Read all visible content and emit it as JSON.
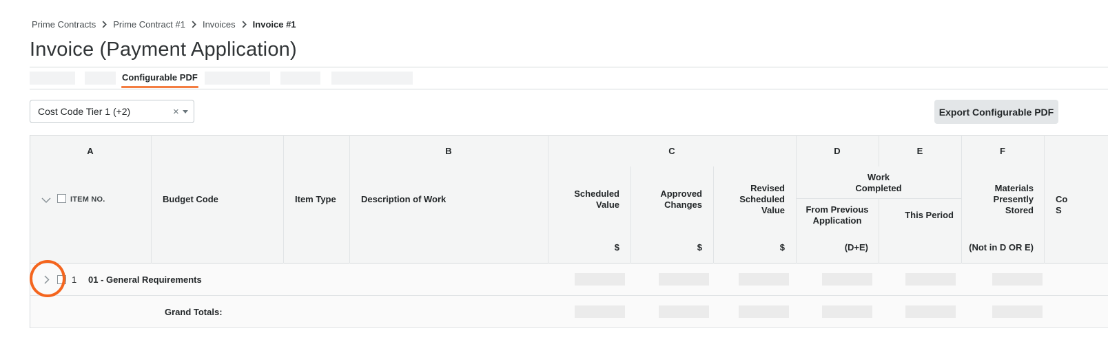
{
  "breadcrumb": [
    {
      "label": "Prime Contracts"
    },
    {
      "label": "Prime Contract #1"
    },
    {
      "label": "Invoices"
    },
    {
      "label": "Invoice #1"
    }
  ],
  "page": {
    "title": "Invoice (Payment Application)"
  },
  "tabs": {
    "active_label": "Configurable PDF"
  },
  "filter": {
    "value": "Cost Code Tier 1 (+2)",
    "clear_symbol": "×"
  },
  "toolbar": {
    "export_label": "Export Configurable PDF"
  },
  "table": {
    "letters": {
      "a": "A",
      "b": "B",
      "c": "C",
      "d": "D",
      "e": "E",
      "f": "F"
    },
    "headers": {
      "item_no": "ITEM NO.",
      "budget_code": "Budget Code",
      "item_type": "Item Type",
      "description": "Description of Work",
      "scheduled_1": "Scheduled",
      "scheduled_2": "Value",
      "approved_1": "Approved",
      "approved_2": "Changes",
      "revised_1": "Revised",
      "revised_2": "Scheduled",
      "revised_3": "Value",
      "work_completed_1": "Work",
      "work_completed_2": "Completed",
      "from_previous_1": "From Previous",
      "from_previous_2": "Application",
      "this_period": "This Period",
      "materials_1": "Materials",
      "materials_2": "Presently",
      "materials_3": "Stored",
      "next_partial_1": "Co",
      "next_partial_2": "S"
    },
    "units": {
      "scheduled": "$",
      "approved": "$",
      "revised": "$",
      "d": "(D+E)",
      "f": "(Not in D OR E)"
    },
    "rows": [
      {
        "item_no": "1",
        "budget_code": "01 - General Requirements"
      }
    ],
    "totals_label": "Grand Totals:"
  },
  "colors": {
    "accent": "#f47e42",
    "highlight": "#f4651e",
    "header_bg": "#f4f5f5",
    "skeleton": "#ebebeb"
  }
}
